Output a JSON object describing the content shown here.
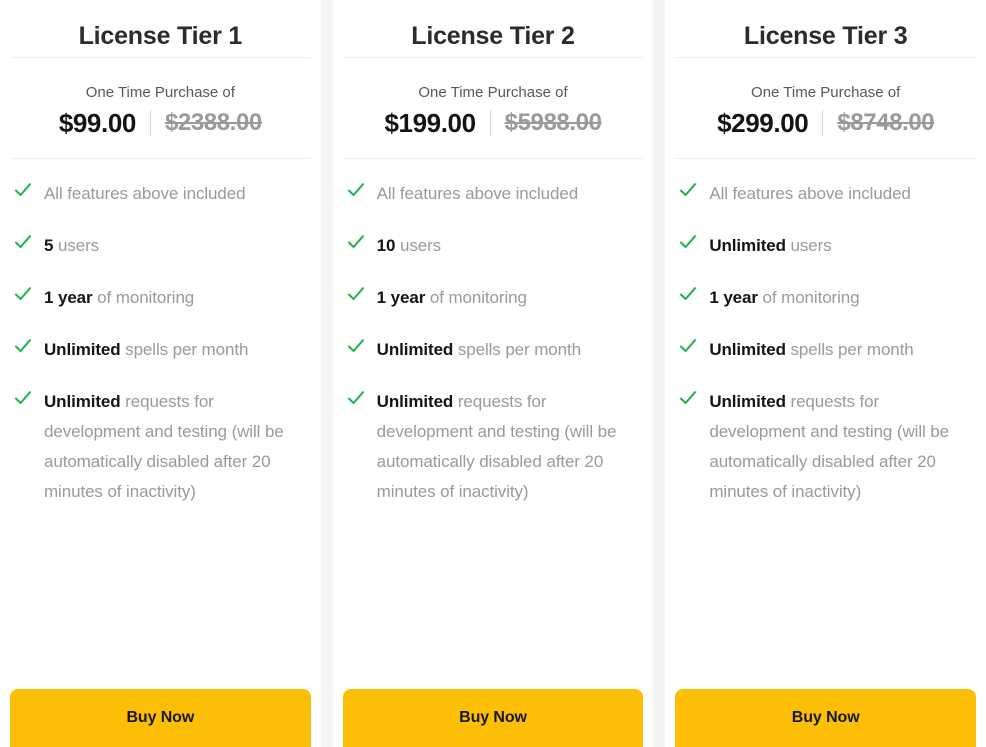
{
  "tiers": [
    {
      "title": "License Tier 1",
      "price_caption": "One Time Purchase of",
      "price_current": "$99.00",
      "price_old": "$2388.00",
      "buy_label": "Buy Now",
      "features": [
        {
          "bold": "",
          "text": "All features above included"
        },
        {
          "bold": "5",
          "text": " users"
        },
        {
          "bold": "1 year",
          "text": " of monitoring"
        },
        {
          "bold": "Unlimited",
          "text": " spells per month"
        },
        {
          "bold": "Unlimited",
          "text": " requests for development and testing (will be automatically disabled after 20 minutes of inactivity)"
        }
      ]
    },
    {
      "title": "License Tier 2",
      "price_caption": "One Time Purchase of",
      "price_current": "$199.00",
      "price_old": "$5988.00",
      "buy_label": "Buy Now",
      "features": [
        {
          "bold": "",
          "text": "All features above included"
        },
        {
          "bold": "10",
          "text": " users"
        },
        {
          "bold": "1 year",
          "text": " of monitoring"
        },
        {
          "bold": "Unlimited",
          "text": " spells per month"
        },
        {
          "bold": "Unlimited",
          "text": " requests for development and testing (will be automatically disabled after 20 minutes of inactivity)"
        }
      ]
    },
    {
      "title": "License Tier 3",
      "price_caption": "One Time Purchase of",
      "price_current": "$299.00",
      "price_old": "$8748.00",
      "buy_label": "Buy Now",
      "features": [
        {
          "bold": "",
          "text": "All features above included"
        },
        {
          "bold": "Unlimited",
          "text": " users"
        },
        {
          "bold": "1 year",
          "text": " of monitoring"
        },
        {
          "bold": "Unlimited",
          "text": " spells per month"
        },
        {
          "bold": "Unlimited",
          "text": " requests for development and testing (will be automatically disabled after 20 minutes of inactivity)"
        }
      ]
    }
  ],
  "icons": {
    "check": "check-icon"
  },
  "colors": {
    "accent_button": "#fcbf06",
    "check_green": "#21b24b",
    "price_current": "#141414",
    "price_old": "#9a9a9a",
    "feature_muted": "#9a9a9a",
    "card_background": "#ffffff",
    "page_background": "#f4f4f4"
  }
}
